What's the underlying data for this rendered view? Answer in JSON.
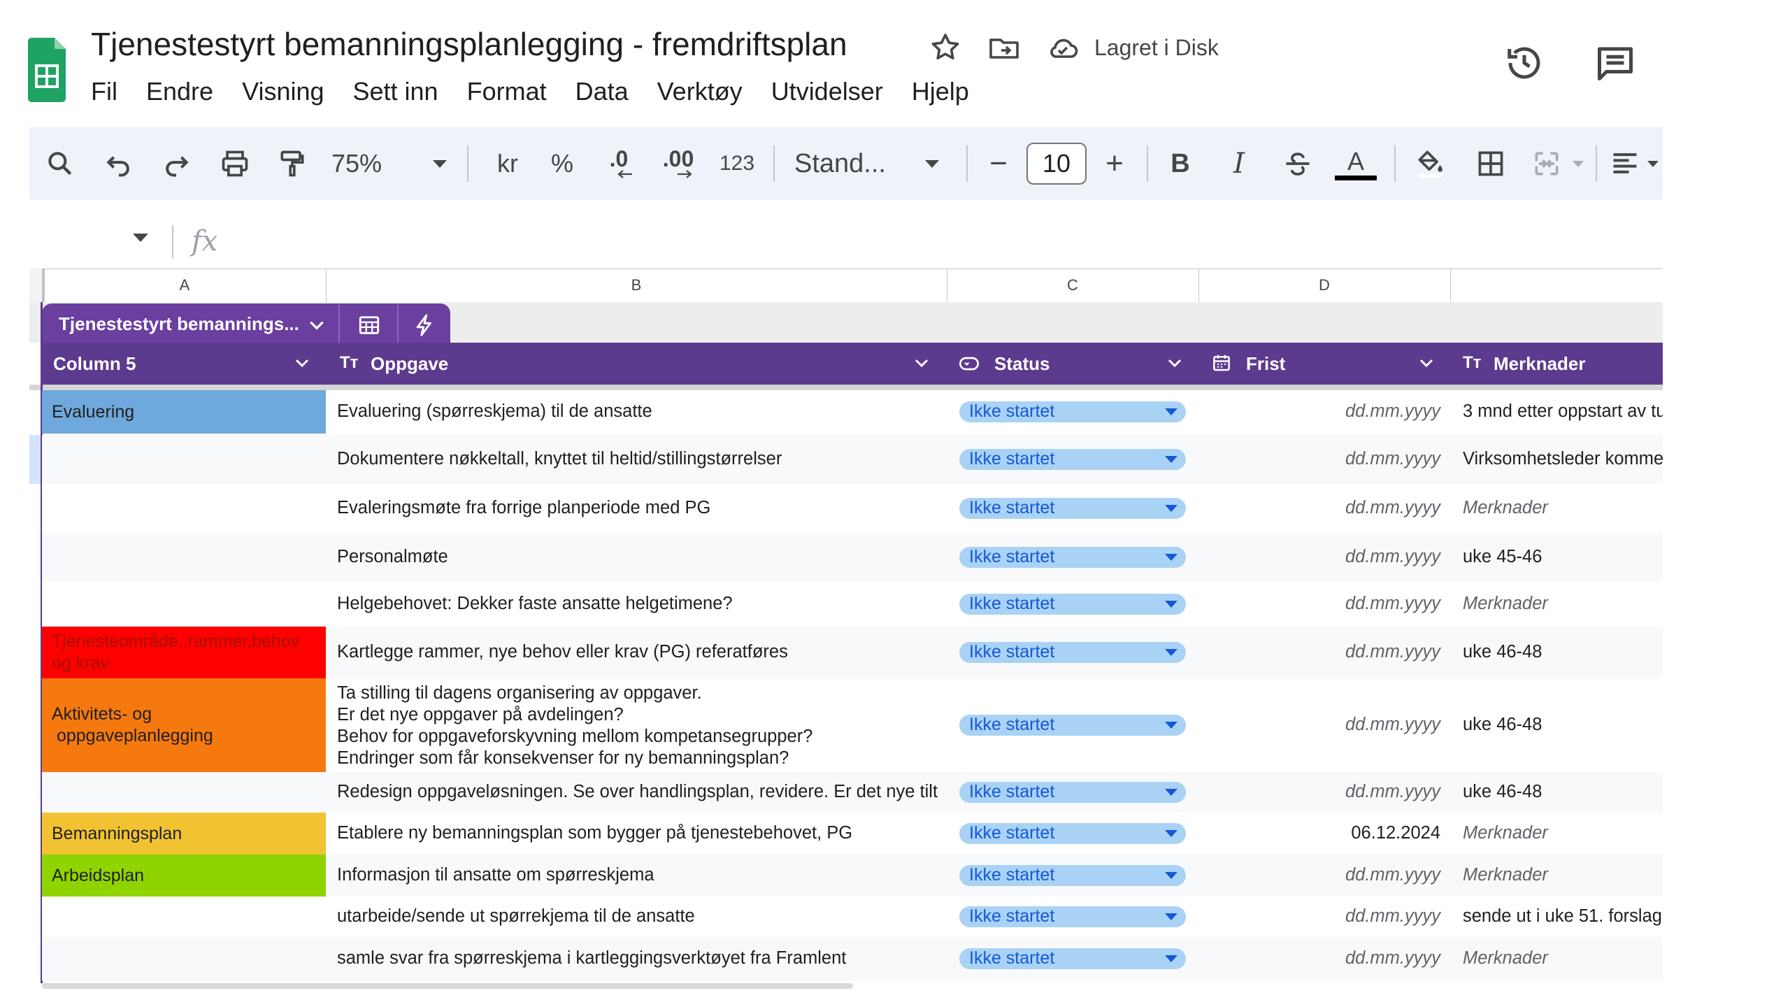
{
  "app": {
    "title": "Tjenestestyrt bemanningsplanlegging - fremdriftsplan",
    "save_status": "Lagret i Disk",
    "menu": [
      "Fil",
      "Endre",
      "Visning",
      "Sett inn",
      "Format",
      "Data",
      "Verktøy",
      "Utvidelser",
      "Hjelp"
    ]
  },
  "toolbar": {
    "zoom": "75%",
    "currency": "kr",
    "percent": "%",
    "dec_decrease": ".0",
    "dec_increase": ".00",
    "number_format": "123",
    "font": "Stand...",
    "minus": "−",
    "font_size": "10",
    "plus": "+",
    "bold": "B",
    "italic": "I",
    "text_color_letter": "A",
    "text_color": "#000000"
  },
  "formula_bar": {
    "fx": "fx"
  },
  "columns": [
    "A",
    "B",
    "C",
    "D"
  ],
  "table": {
    "name": "Tjenestestyrt bemannings...",
    "headers": {
      "a": "Column 5",
      "b": "Oppgave",
      "c": "Status",
      "d": "Frist",
      "e": "Merknader",
      "text_type_icon": "Tт"
    }
  },
  "rows": [
    {
      "category": "Evaluering",
      "task": "Evaluering (spørreskjema) til de ansatte",
      "status": "Ikke startet",
      "deadline": "dd.mm.yyyy",
      "note": "3 mnd etter oppstart av tu"
    },
    {
      "category": "",
      "task": "Dokumentere nøkkeltall, knyttet til heltid/stillingstørrelser",
      "status": "Ikke startet",
      "deadline": "dd.mm.yyyy",
      "note": "Virksomhetsleder komme"
    },
    {
      "category": "",
      "task": "Evaleringsmøte  fra forrige planperiode med PG",
      "status": "Ikke startet",
      "deadline": "dd.mm.yyyy",
      "note": "Merknader"
    },
    {
      "category": "",
      "task": "Personalmøte",
      "status": "Ikke startet",
      "deadline": "dd.mm.yyyy",
      "note": "uke 45-46"
    },
    {
      "category": "",
      "task": "Helgebehovet: Dekker faste ansatte helgetimene?",
      "status": "Ikke startet",
      "deadline": "dd.mm.yyyy",
      "note": "Merknader"
    },
    {
      "category": "Tjenesteområde, rammer,behov og krav",
      "task": "Kartlegge rammer, nye behov eller krav (PG) referatføres",
      "status": "Ikke startet",
      "deadline": "dd.mm.yyyy",
      "note": "uke 46-48"
    },
    {
      "category": "Aktivitets- og\n oppgaveplanlegging",
      "task": "Ta stilling til dagens organisering av oppgaver.\nEr det nye oppgaver på avdelingen?\nBehov for oppgaveforskyvning mellom kompetansegrupper?\nEndringer som får konsekvenser for ny bemanningsplan?",
      "status": "Ikke startet",
      "deadline": "dd.mm.yyyy",
      "note": "uke 46-48"
    },
    {
      "category": "",
      "task": "Redesign oppgaveløsningen. Se over handlingsplan, revidere. Er det nye tilt",
      "status": "Ikke startet",
      "deadline": "dd.mm.yyyy",
      "note": "uke 46-48"
    },
    {
      "category": "Bemanningsplan",
      "task": "Etablere ny bemanningsplan som bygger på tjenestebehovet, PG",
      "status": "Ikke startet",
      "deadline": "06.12.2024",
      "note": "Merknader"
    },
    {
      "category": "Arbeidsplan",
      "task": "Informasjon til ansatte om spørreskjema",
      "status": "Ikke startet",
      "deadline": "dd.mm.yyyy",
      "note": "Merknader"
    },
    {
      "category": "",
      "task": "utarbeide/sende ut spørrekjema til de ansatte",
      "status": "Ikke startet",
      "deadline": "dd.mm.yyyy",
      "note": "sende ut i uke 51. forslag"
    },
    {
      "category": "",
      "task": "samle svar fra spørreskjema i kartleggingsverktøyet fra Framlent",
      "status": "Ikke startet",
      "deadline": "dd.mm.yyyy",
      "note": "Merknader"
    }
  ],
  "colors": {
    "table_purple": "#5c3a8e",
    "status_chip": "#a9d2f5",
    "evaluering": "#6fa8dc",
    "tjenesteomrade": "#ff0000",
    "aktivitet": "#f5790f",
    "bemanningsplan": "#f1c232",
    "arbeidsplan": "#8fd400"
  }
}
